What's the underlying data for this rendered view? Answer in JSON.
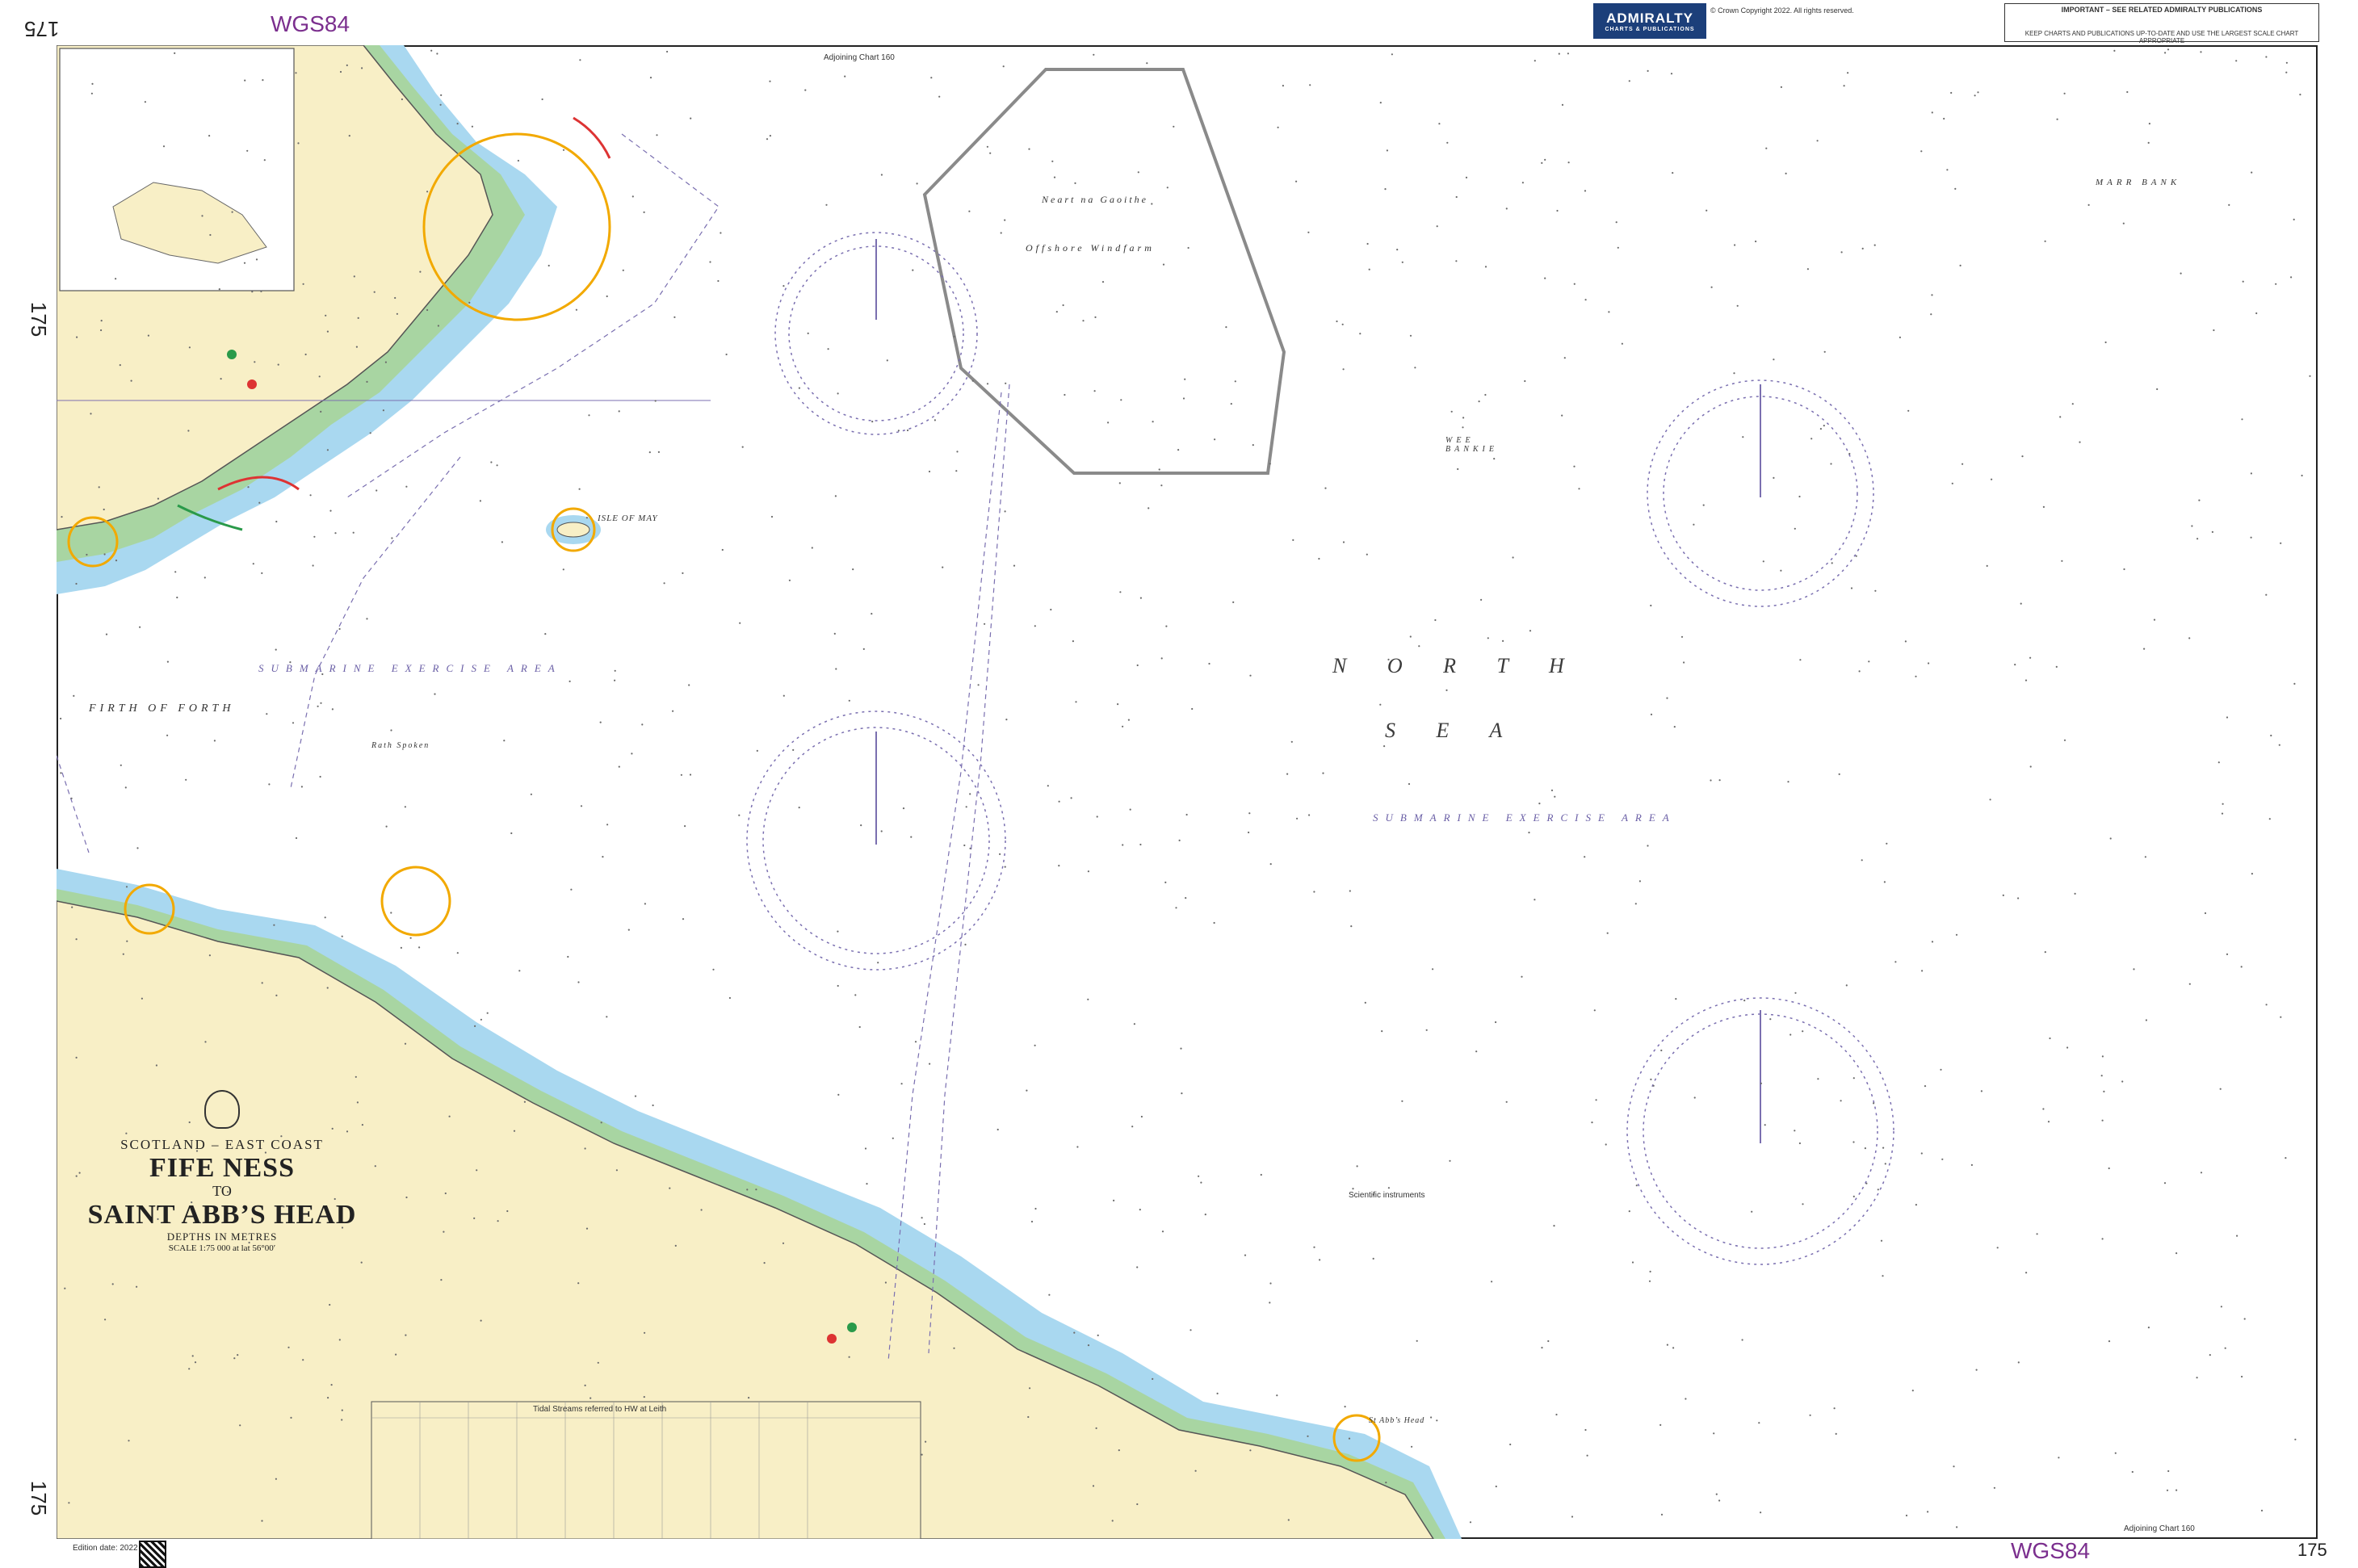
{
  "header": {
    "chart_number_rotated": "175",
    "datum_top": "WGS84",
    "datum_bottom": "WGS84",
    "chart_number_bottom": "175",
    "admiralty_brand": "ADMIRALTY",
    "admiralty_sub": "CHARTS & PUBLICATIONS",
    "copyright_text": "© Crown Copyright 2022. All rights reserved.",
    "notice_title": "IMPORTANT – SEE RELATED ADMIRALTY PUBLICATIONS",
    "notice_body": "KEEP CHARTS AND PUBLICATIONS UP-TO-DATE AND USE THE LARGEST SCALE CHART APPROPRIATE",
    "adjoining_top": "Adjoining Chart 160",
    "adjoining_bottom": "Adjoining Chart 160"
  },
  "title": {
    "region": "SCOTLAND – EAST COAST",
    "line1": "FIFE NESS",
    "to": "TO",
    "line2": "SAINT ABB’S HEAD",
    "depths": "DEPTHS IN METRES",
    "scale": "SCALE 1:75 000 at lat 56°00′"
  },
  "labels": {
    "north": "N O R T H",
    "sea": "S E A",
    "submarine_exercise_area": "SUBMARINE EXERCISE AREA",
    "firth_of_forth": "FIRTH OF FORTH",
    "isle_of_may": "ISLE OF MAY",
    "marr_bank": "MARR BANK",
    "wee_bankie": "WEE BANKIE",
    "offshore_windfarm": "Offshore Windfarm",
    "neart_na_gaoithe": "Neart na Gaoithe",
    "bath_spoken": "Rath Spoken",
    "st_abbs_head": "St Abb’s Head",
    "sewer_label": "Scientific instruments"
  },
  "footer": {
    "tidal_title": "Tidal Streams referred to HW at Leith",
    "edition": "Edition date: 2022"
  },
  "colors": {
    "land": "#f8efc6",
    "shallow": "#a9d8f0",
    "intertidal": "#a8d5a2",
    "deep": "#ffffff",
    "datum_purple": "#7b2f8e",
    "windfarm_outline": "#8a8a8a",
    "light_sector": "#f2a900",
    "compass_rose": "#7a6fb0"
  },
  "icons": [
    "qr-code-icon",
    "crest-icon",
    "compass-rose-icon",
    "light-sector-icon"
  ]
}
